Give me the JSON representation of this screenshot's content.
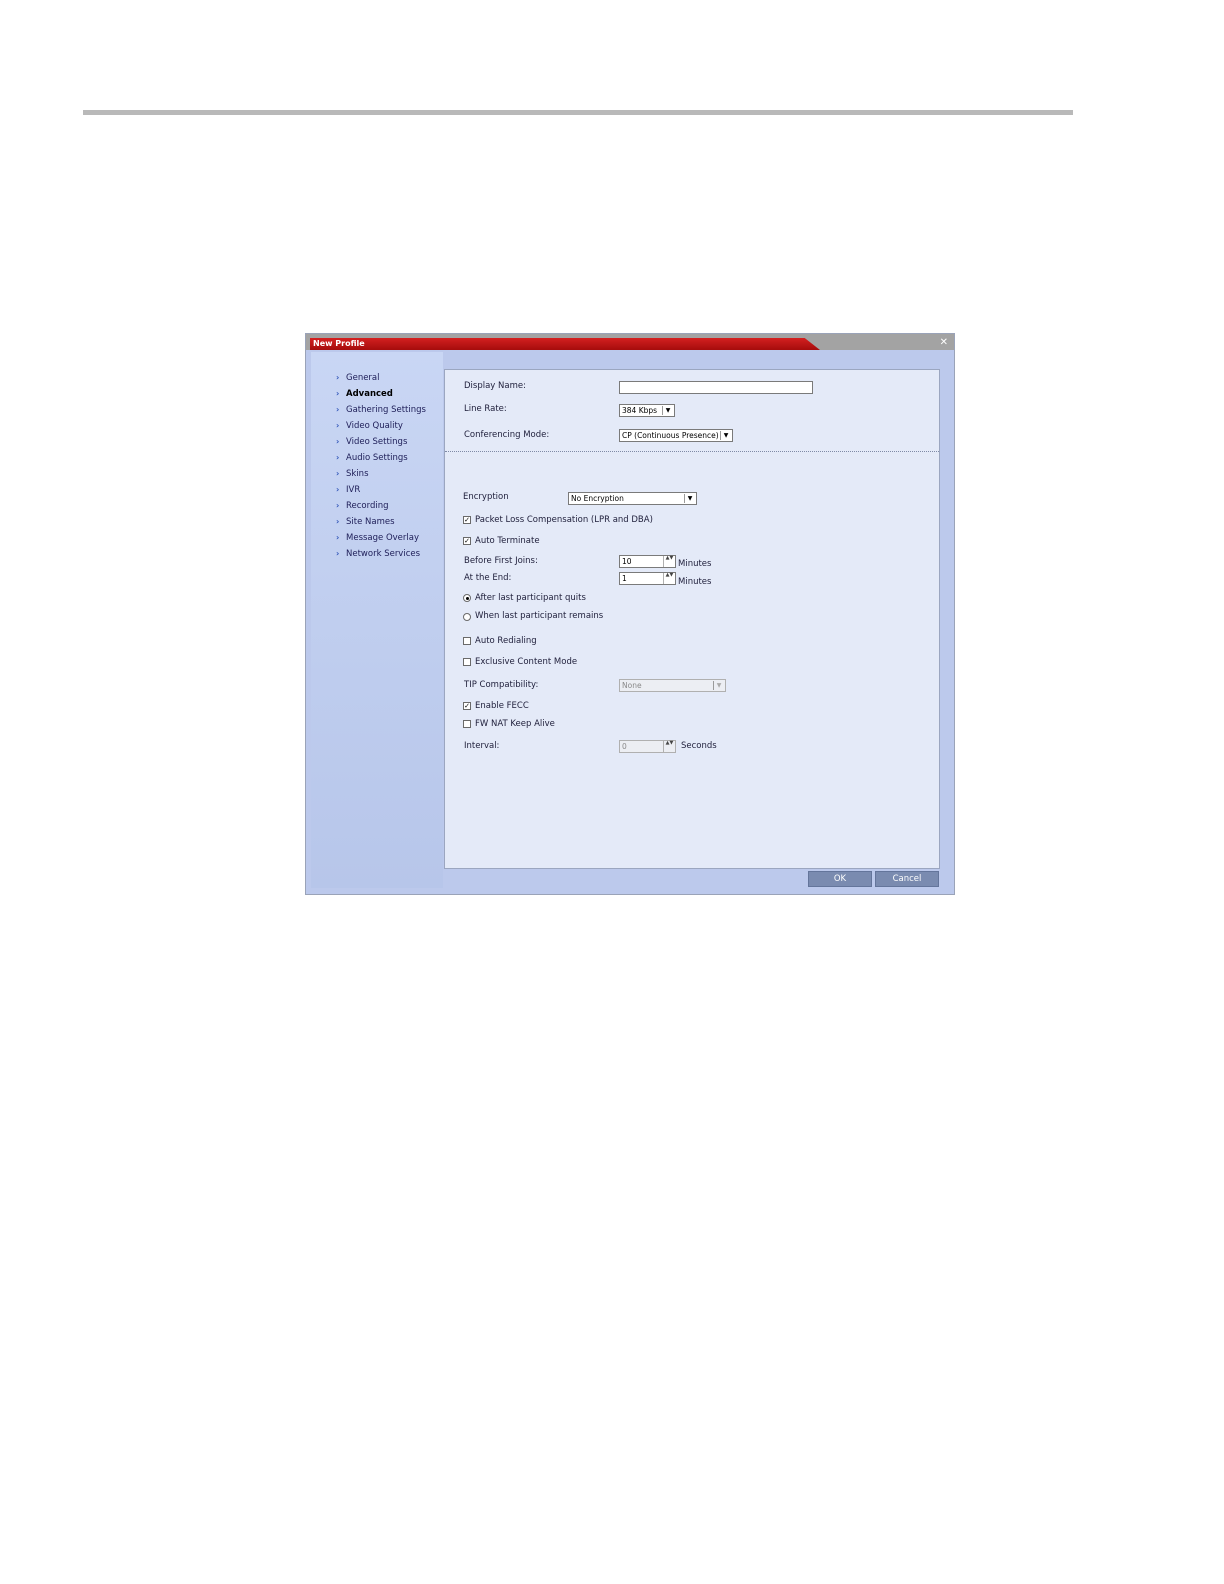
{
  "dialog": {
    "title": "New Profile",
    "close_glyph": "✕",
    "close_icon": "close-icon"
  },
  "nav": {
    "chevron_glyph": "›",
    "items": [
      {
        "label": "General",
        "active": false
      },
      {
        "label": "Advanced",
        "active": true
      },
      {
        "label": "Gathering Settings",
        "active": false
      },
      {
        "label": "Video Quality",
        "active": false
      },
      {
        "label": "Video Settings",
        "active": false
      },
      {
        "label": "Audio Settings",
        "active": false
      },
      {
        "label": "Skins",
        "active": false
      },
      {
        "label": "IVR",
        "active": false
      },
      {
        "label": "Recording",
        "active": false
      },
      {
        "label": "Site Names",
        "active": false
      },
      {
        "label": "Message Overlay",
        "active": false
      },
      {
        "label": "Network Services",
        "active": false
      }
    ]
  },
  "form": {
    "display_name": {
      "label": "Display Name:",
      "value": ""
    },
    "line_rate": {
      "label": "Line Rate:",
      "value": "384 Kbps"
    },
    "conferencing_mode": {
      "label": "Conferencing Mode:",
      "value": "CP (Continuous Presence)"
    },
    "encryption": {
      "label": "Encryption",
      "value": "No Encryption"
    },
    "packet_loss": {
      "label": "Packet Loss Compensation (LPR and DBA)",
      "checked": true
    },
    "auto_terminate": {
      "label": "Auto Terminate",
      "checked": true
    },
    "before_first_joins": {
      "label": "Before First Joins:",
      "value": "10",
      "unit": "Minutes"
    },
    "at_the_end": {
      "label": "At the End:",
      "value": "1",
      "unit": "Minutes"
    },
    "after_last_quits": {
      "label": "After last participant quits",
      "selected": true
    },
    "when_last_remains": {
      "label": "When last participant remains",
      "selected": false
    },
    "auto_redialing": {
      "label": "Auto Redialing",
      "checked": false
    },
    "exclusive_content": {
      "label": "Exclusive Content Mode",
      "checked": false
    },
    "tip_compatibility": {
      "label": "TIP Compatibility:",
      "value": "None"
    },
    "enable_fecc": {
      "label": "Enable FECC",
      "checked": true
    },
    "fw_nat_keep_alive": {
      "label": "FW NAT Keep Alive",
      "checked": false
    },
    "interval": {
      "label": "Interval:",
      "value": "0",
      "unit": "Seconds"
    },
    "check_glyph": "✓",
    "dropdown_glyph": "▼",
    "spin_glyph": "▲▼"
  },
  "buttons": {
    "ok": "OK",
    "cancel": "Cancel"
  }
}
